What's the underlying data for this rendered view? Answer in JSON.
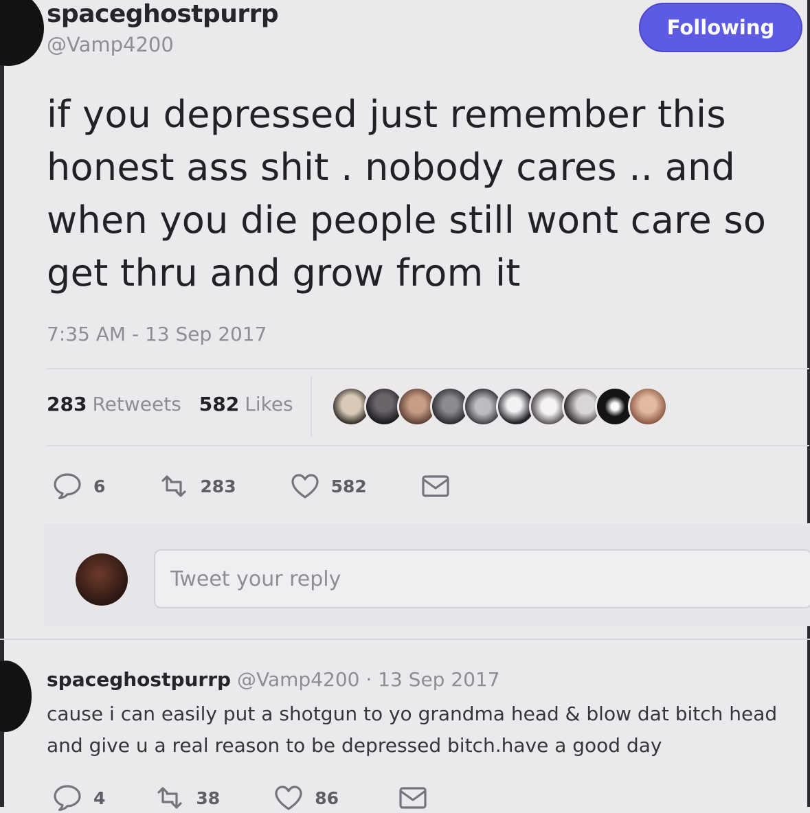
{
  "tweet": {
    "display_name": "spaceghostpurrp",
    "handle": "@Vamp4200",
    "follow_button": "Following",
    "text_lines": [
      "if you depressed just remember this",
      "honest ass shit . nobody cares .. and",
      "when you die people still wont care so",
      "get thru and grow from it"
    ],
    "timestamp": "7:35 AM - 13 Sep 2017",
    "retweets_count": "283",
    "retweets_label": "Retweets",
    "likes_count": "582",
    "likes_label": "Likes",
    "actions": {
      "replies": "6",
      "retweets": "283",
      "likes": "582"
    }
  },
  "reply_composer": {
    "placeholder": "Tweet your reply"
  },
  "reply": {
    "display_name": "spaceghostpurrp",
    "meta": "@Vamp4200 · 13 Sep 2017",
    "text_lines": [
      "cause i can easily put a shotgun to yo grandma head & blow dat bitch head",
      "and give u a real reason to be depressed bitch.have a good day"
    ],
    "actions": {
      "replies": "4",
      "retweets": "38",
      "likes": "86"
    }
  },
  "colors": {
    "follow_button": "#5d5ae3",
    "background": "#ebe9ec",
    "muted_text": "#8e8d93"
  },
  "icons": [
    "reply-icon",
    "retweet-icon",
    "like-icon",
    "message-icon"
  ]
}
